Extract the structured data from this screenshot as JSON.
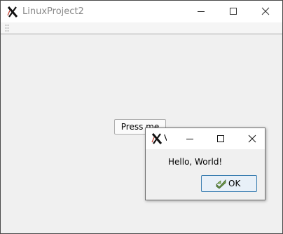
{
  "main_window": {
    "title": "LinuxProject2",
    "icon": "x-logo-icon",
    "controls": [
      "minimize-icon",
      "maximize-icon",
      "close-icon"
    ]
  },
  "central": {
    "press_button_label": "Press me"
  },
  "dialog": {
    "title": "V",
    "icon": "x-logo-icon",
    "message": "Hello, World!",
    "ok_label": "OK",
    "ok_icon": "ok-check-icon",
    "controls": [
      "minimize-icon",
      "maximize-icon",
      "close-icon"
    ]
  },
  "colors": {
    "titlebar": "#ffffff",
    "background": "#f0f0f0",
    "title_text": "#8a8a8a",
    "ok_border": "#3c7fb1",
    "ok_icon": "#5a8a3a"
  }
}
